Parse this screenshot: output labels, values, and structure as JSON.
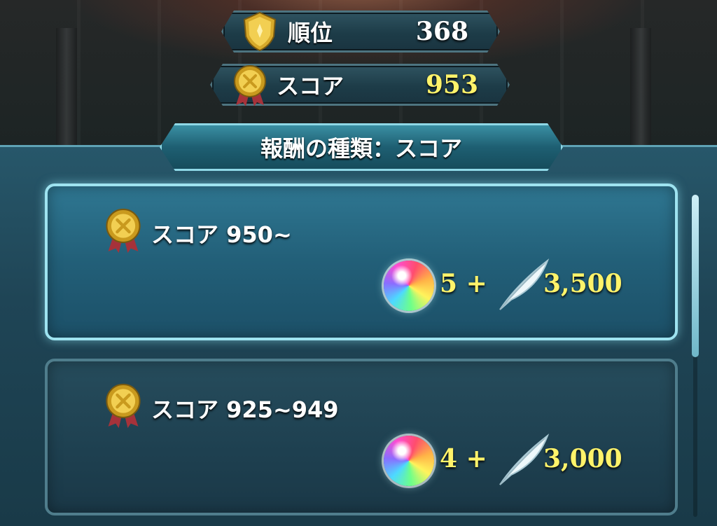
{
  "header": {
    "rank": {
      "label": "順位",
      "value": "368",
      "value_color": "#ffffff"
    },
    "score": {
      "label": "スコア",
      "value": "953",
      "value_color": "#fff36a"
    }
  },
  "reward_type_title": "報酬の種類：スコア",
  "tiers": [
    {
      "label": "スコア 950~",
      "orbs": "5 +",
      "feathers": "3,500",
      "highlighted": true
    },
    {
      "label": "スコア 925~949",
      "orbs": "4 +",
      "feathers": "3,000",
      "highlighted": false
    }
  ],
  "icons": {
    "rank": "shield-medal-icon",
    "score": "gold-medal-icon",
    "orb": "rainbow-orb-icon",
    "feather": "feather-icon"
  }
}
